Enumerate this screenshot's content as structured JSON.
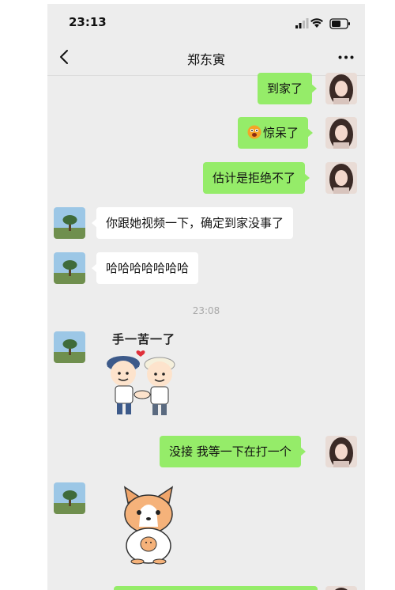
{
  "status_bar": {
    "time": "23:13"
  },
  "header": {
    "title": "郑东寅"
  },
  "messages": {
    "m1": {
      "text": "到家了"
    },
    "m2": {
      "text": "惊呆了",
      "emoji": "surprised-face-emoji"
    },
    "m3": {
      "text": "估计是拒绝不了"
    },
    "m4": {
      "text": "你跟她视频一下，确定到家没事了"
    },
    "m5": {
      "text": "哈哈哈哈哈哈哈"
    },
    "time_divider": "23:08",
    "sticker1": {
      "caption": "手一苦一了",
      "icon": "two-friends-handshake-sticker"
    },
    "m6": {
      "text": "没接 我等一下在打一个"
    },
    "sticker2": {
      "icon": "corgi-holding-puppy-sticker"
    }
  },
  "colors": {
    "outgoing_bubble": "#95ec69",
    "incoming_bubble": "#ffffff",
    "chat_background": "#ededed"
  }
}
